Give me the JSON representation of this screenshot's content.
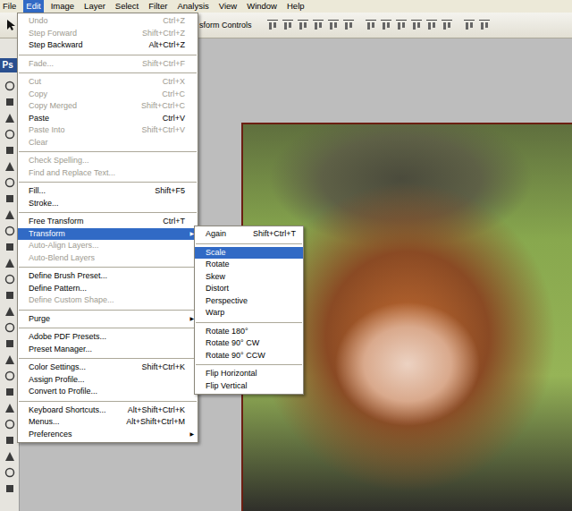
{
  "app_logo": "Ps",
  "menu_bar": [
    {
      "label": "File",
      "selected": false
    },
    {
      "label": "Edit",
      "selected": true
    },
    {
      "label": "Image",
      "selected": false
    },
    {
      "label": "Layer",
      "selected": false
    },
    {
      "label": "Select",
      "selected": false
    },
    {
      "label": "Filter",
      "selected": false
    },
    {
      "label": "Analysis",
      "selected": false
    },
    {
      "label": "View",
      "selected": false
    },
    {
      "label": "Window",
      "selected": false
    },
    {
      "label": "Help",
      "selected": false
    }
  ],
  "options_bar": {
    "text": "sform Controls"
  },
  "submenu_arrow": "▶",
  "edit_menu": {
    "items": [
      {
        "kind": "item",
        "label": "Undo",
        "shortcut": "Ctrl+Z",
        "disabled": true,
        "selected": false,
        "submenu": false
      },
      {
        "kind": "item",
        "label": "Step Forward",
        "shortcut": "Shift+Ctrl+Z",
        "disabled": true,
        "selected": false,
        "submenu": false
      },
      {
        "kind": "item",
        "label": "Step Backward",
        "shortcut": "Alt+Ctrl+Z",
        "disabled": false,
        "selected": false,
        "submenu": false
      },
      {
        "kind": "separator"
      },
      {
        "kind": "item",
        "label": "Fade...",
        "shortcut": "Shift+Ctrl+F",
        "disabled": true,
        "selected": false,
        "submenu": false
      },
      {
        "kind": "separator"
      },
      {
        "kind": "item",
        "label": "Cut",
        "shortcut": "Ctrl+X",
        "disabled": true,
        "selected": false,
        "submenu": false
      },
      {
        "kind": "item",
        "label": "Copy",
        "shortcut": "Ctrl+C",
        "disabled": true,
        "selected": false,
        "submenu": false
      },
      {
        "kind": "item",
        "label": "Copy Merged",
        "shortcut": "Shift+Ctrl+C",
        "disabled": true,
        "selected": false,
        "submenu": false
      },
      {
        "kind": "item",
        "label": "Paste",
        "shortcut": "Ctrl+V",
        "disabled": false,
        "selected": false,
        "submenu": false
      },
      {
        "kind": "item",
        "label": "Paste Into",
        "shortcut": "Shift+Ctrl+V",
        "disabled": true,
        "selected": false,
        "submenu": false
      },
      {
        "kind": "item",
        "label": "Clear",
        "disabled": true,
        "selected": false,
        "submenu": false
      },
      {
        "kind": "separator"
      },
      {
        "kind": "item",
        "label": "Check Spelling...",
        "disabled": true,
        "selected": false,
        "submenu": false
      },
      {
        "kind": "item",
        "label": "Find and Replace Text...",
        "disabled": true,
        "selected": false,
        "submenu": false
      },
      {
        "kind": "separator"
      },
      {
        "kind": "item",
        "label": "Fill...",
        "shortcut": "Shift+F5",
        "disabled": false,
        "selected": false,
        "submenu": false
      },
      {
        "kind": "item",
        "label": "Stroke...",
        "disabled": false,
        "selected": false,
        "submenu": false
      },
      {
        "kind": "separator"
      },
      {
        "kind": "item",
        "label": "Free Transform",
        "shortcut": "Ctrl+T",
        "disabled": false,
        "selected": false,
        "submenu": false
      },
      {
        "kind": "item",
        "label": "Transform",
        "disabled": false,
        "selected": true,
        "submenu": true
      },
      {
        "kind": "item",
        "label": "Auto-Align Layers...",
        "disabled": true,
        "selected": false,
        "submenu": false
      },
      {
        "kind": "item",
        "label": "Auto-Blend Layers",
        "disabled": true,
        "selected": false,
        "submenu": false
      },
      {
        "kind": "separator"
      },
      {
        "kind": "item",
        "label": "Define Brush Preset...",
        "disabled": false,
        "selected": false,
        "submenu": false
      },
      {
        "kind": "item",
        "label": "Define Pattern...",
        "disabled": false,
        "selected": false,
        "submenu": false
      },
      {
        "kind": "item",
        "label": "Define Custom Shape...",
        "disabled": true,
        "selected": false,
        "submenu": false
      },
      {
        "kind": "separator"
      },
      {
        "kind": "item",
        "label": "Purge",
        "disabled": false,
        "selected": false,
        "submenu": true
      },
      {
        "kind": "separator"
      },
      {
        "kind": "item",
        "label": "Adobe PDF Presets...",
        "disabled": false,
        "selected": false,
        "submenu": false
      },
      {
        "kind": "item",
        "label": "Preset Manager...",
        "disabled": false,
        "selected": false,
        "submenu": false
      },
      {
        "kind": "separator"
      },
      {
        "kind": "item",
        "label": "Color Settings...",
        "shortcut": "Shift+Ctrl+K",
        "disabled": false,
        "selected": false,
        "submenu": false
      },
      {
        "kind": "item",
        "label": "Assign Profile...",
        "disabled": false,
        "selected": false,
        "submenu": false
      },
      {
        "kind": "item",
        "label": "Convert to Profile...",
        "disabled": false,
        "selected": false,
        "submenu": false
      },
      {
        "kind": "separator"
      },
      {
        "kind": "item",
        "label": "Keyboard Shortcuts...",
        "shortcut": "Alt+Shift+Ctrl+K",
        "disabled": false,
        "selected": false,
        "submenu": false
      },
      {
        "kind": "item",
        "label": "Menus...",
        "shortcut": "Alt+Shift+Ctrl+M",
        "disabled": false,
        "selected": false,
        "submenu": false
      },
      {
        "kind": "item",
        "label": "Preferences",
        "disabled": false,
        "selected": false,
        "submenu": true
      }
    ]
  },
  "transform_submenu": {
    "items": [
      {
        "kind": "item",
        "label": "Again",
        "shortcut": "Shift+Ctrl+T",
        "disabled": false,
        "selected": false
      },
      {
        "kind": "separator"
      },
      {
        "kind": "item",
        "label": "Scale",
        "disabled": false,
        "selected": true
      },
      {
        "kind": "item",
        "label": "Rotate",
        "disabled": false,
        "selected": false
      },
      {
        "kind": "item",
        "label": "Skew",
        "disabled": false,
        "selected": false
      },
      {
        "kind": "item",
        "label": "Distort",
        "disabled": false,
        "selected": false
      },
      {
        "kind": "item",
        "label": "Perspective",
        "disabled": false,
        "selected": false
      },
      {
        "kind": "item",
        "label": "Warp",
        "disabled": false,
        "selected": false
      },
      {
        "kind": "separator"
      },
      {
        "kind": "item",
        "label": "Rotate 180°",
        "disabled": false,
        "selected": false
      },
      {
        "kind": "item",
        "label": "Rotate 90° CW",
        "disabled": false,
        "selected": false
      },
      {
        "kind": "item",
        "label": "Rotate 90° CCW",
        "disabled": false,
        "selected": false
      },
      {
        "kind": "separator"
      },
      {
        "kind": "item",
        "label": "Flip Horizontal",
        "disabled": false,
        "selected": false
      },
      {
        "kind": "item",
        "label": "Flip Vertical",
        "disabled": false,
        "selected": false
      }
    ]
  }
}
